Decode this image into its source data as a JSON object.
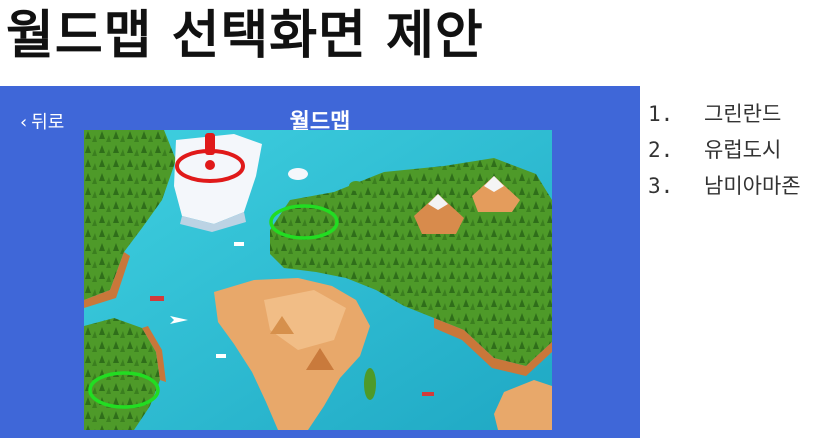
{
  "slide": {
    "title": "월드맵 선택화면 제안"
  },
  "screen": {
    "back_label": "뒤로",
    "back_icon": "chevron-left-icon",
    "title": "월드맵"
  },
  "map": {
    "markers": [
      {
        "name": "greenland",
        "style": "red-ring-with-exclamation",
        "color": "#e01a1a"
      },
      {
        "name": "europe-city",
        "style": "green-ring",
        "color": "#22dd22"
      },
      {
        "name": "south-america-amazon",
        "style": "green-ring",
        "color": "#22dd22"
      }
    ],
    "colors": {
      "ocean": "#38c6d6",
      "land": "#5aa52c",
      "desert": "#e8a86a",
      "ice": "#f4f7fb"
    }
  },
  "options": [
    {
      "num": "1.",
      "label": "그린란드"
    },
    {
      "num": "2.",
      "label": "유럽도시"
    },
    {
      "num": "3.",
      "label": "남미아마존"
    }
  ],
  "colors": {
    "panel": "#3f67d8",
    "title_text": "#111111"
  }
}
